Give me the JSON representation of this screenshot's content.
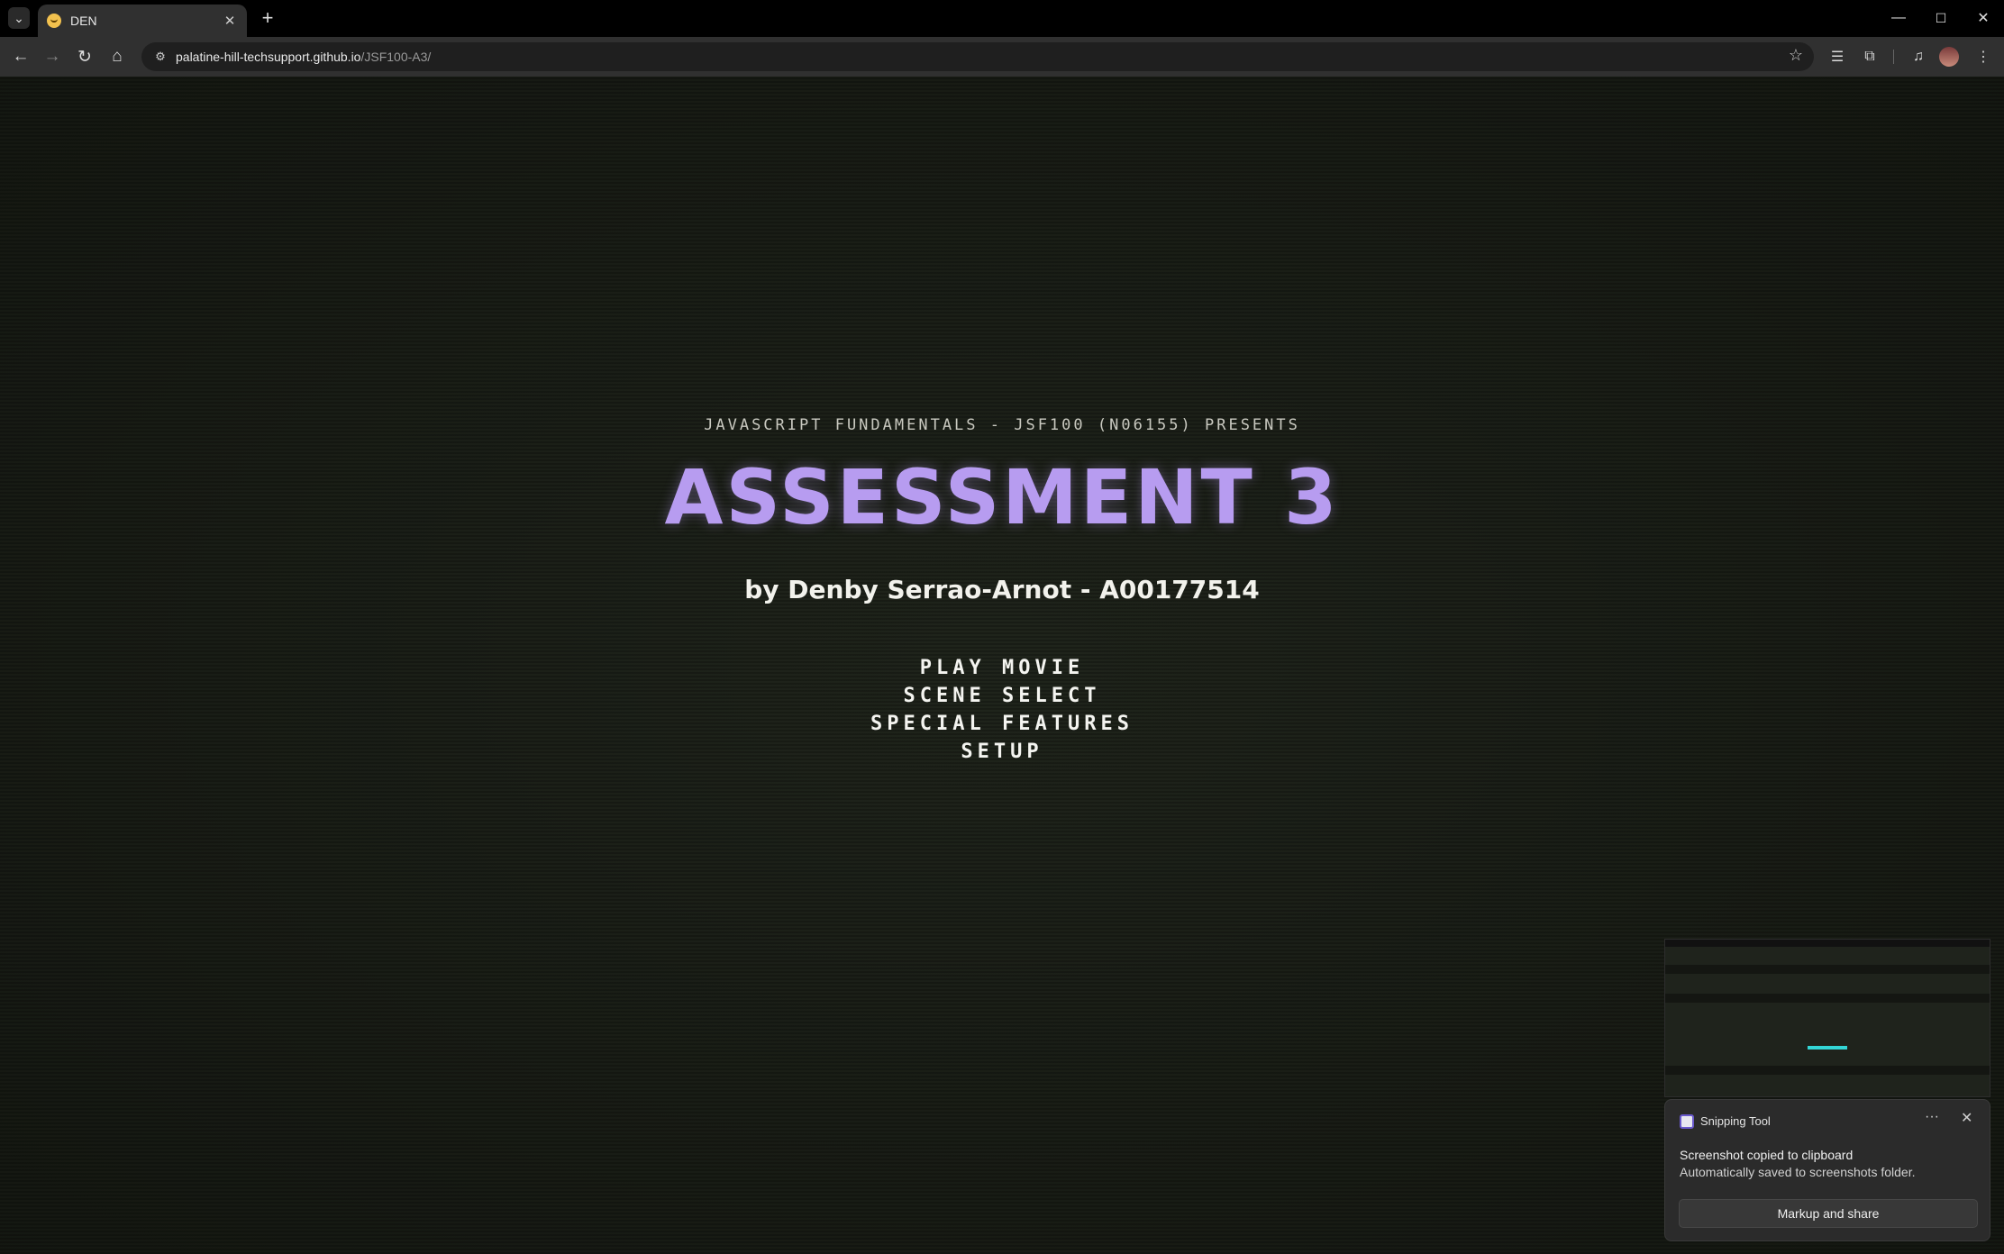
{
  "browser": {
    "tab_title": "DEN",
    "new_tab_symbol": "+",
    "url_host": "palatine-hill-techsupport.github.io",
    "url_path": "/JSF100-A3/",
    "window_controls": {
      "minimize": "—",
      "maximize": "☐",
      "close": "✕"
    },
    "icons": [
      "tab-search-icon",
      "favicon-icon",
      "close-icon",
      "back-icon",
      "forward-icon",
      "reload-icon",
      "home-icon",
      "site-info-icon",
      "star-icon",
      "reading-list-icon",
      "extensions-icon",
      "media-icon",
      "profile-avatar",
      "kebab-menu-icon"
    ]
  },
  "page": {
    "presents": "JAVASCRIPT FUNDAMENTALS - JSF100 (N06155) PRESENTS",
    "title": "ASSESSMENT 3",
    "byline": "by Denby Serrao-Arnot - A00177514",
    "menu": [
      "PLAY MOVIE",
      "SCENE SELECT",
      "SPECIAL FEATURES",
      "SETUP"
    ],
    "colors": {
      "background": "#1b1f17",
      "title": "#b79cf0",
      "text": "#f4f4f0"
    }
  },
  "notification": {
    "app": "Snipping Tool",
    "heading": "Screenshot copied to clipboard",
    "body": "Automatically saved to screenshots folder.",
    "button": "Markup and share",
    "more_symbol": "···",
    "close_symbol": "✕"
  }
}
